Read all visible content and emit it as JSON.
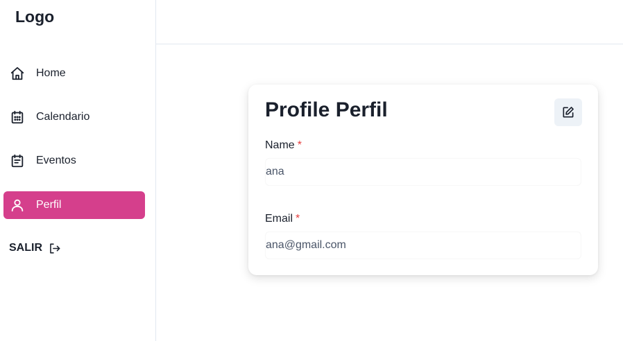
{
  "sidebar": {
    "logo": "Logo",
    "items": [
      {
        "label": "Home",
        "icon": "home-icon"
      },
      {
        "label": "Calendario",
        "icon": "calendar-icon"
      },
      {
        "label": "Eventos",
        "icon": "event-icon"
      },
      {
        "label": "Perfil",
        "icon": "user-icon",
        "active": true
      }
    ],
    "logout_label": "SALIR",
    "logout_icon": "logout-icon"
  },
  "profile": {
    "title": "Profile Perfil",
    "edit_icon": "edit-icon",
    "fields": [
      {
        "label": "Name",
        "required": "*",
        "value": "ana"
      },
      {
        "label": "Email",
        "required": "*",
        "value": "ana@gmail.com"
      }
    ]
  },
  "colors": {
    "accent": "#d53f8c",
    "required": "#e53e3e",
    "edit_button_bg": "#edf2f7"
  }
}
